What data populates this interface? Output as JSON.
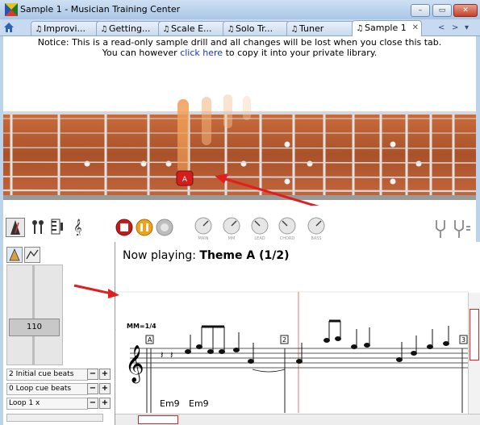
{
  "window": {
    "title": "Sample 1 - Musician Training Center",
    "buttons": {
      "minimize": "–",
      "restore": "▭",
      "close": "✕"
    }
  },
  "tabs": [
    {
      "label": "Improvi...",
      "active": false
    },
    {
      "label": "Getting...",
      "active": false
    },
    {
      "label": "Scale E...",
      "active": false
    },
    {
      "label": "Solo Tr...",
      "active": false
    },
    {
      "label": "Tuner",
      "active": false
    },
    {
      "label": "Sample 1",
      "active": true
    }
  ],
  "tab_nav": {
    "left": "<",
    "right": ">",
    "menu": "▾"
  },
  "notice": {
    "line1": "Notice: This is a read-only sample drill and all changes will be lost when you close this tab.",
    "line2_before": "You can however ",
    "link": "click here",
    "line2_after": " to copy it into your private library."
  },
  "fretboard": {
    "highlight_note": "A",
    "accent": "#cc1a1a"
  },
  "transport": {
    "dials": [
      "MAIN",
      "MM",
      "LEAD",
      "CHORD",
      "BASS"
    ]
  },
  "side_panel": {
    "tempo_value": "110",
    "controls": [
      {
        "label": "2 Initial cue beats"
      },
      {
        "label": "0 Loop cue beats"
      },
      {
        "label": "Loop 1 x"
      }
    ]
  },
  "score": {
    "now_playing_prefix": "Now playing: ",
    "now_playing_title": "Theme A (1/2)",
    "tempo_marking": "MM=1/4",
    "rehearsal_marks": [
      "A",
      "2",
      "3"
    ],
    "chords": [
      "Em9",
      "Em9"
    ]
  },
  "colors": {
    "accent": "#cc1a1a",
    "window_blue": "#bcd3ea",
    "wood": "#b5582a"
  }
}
